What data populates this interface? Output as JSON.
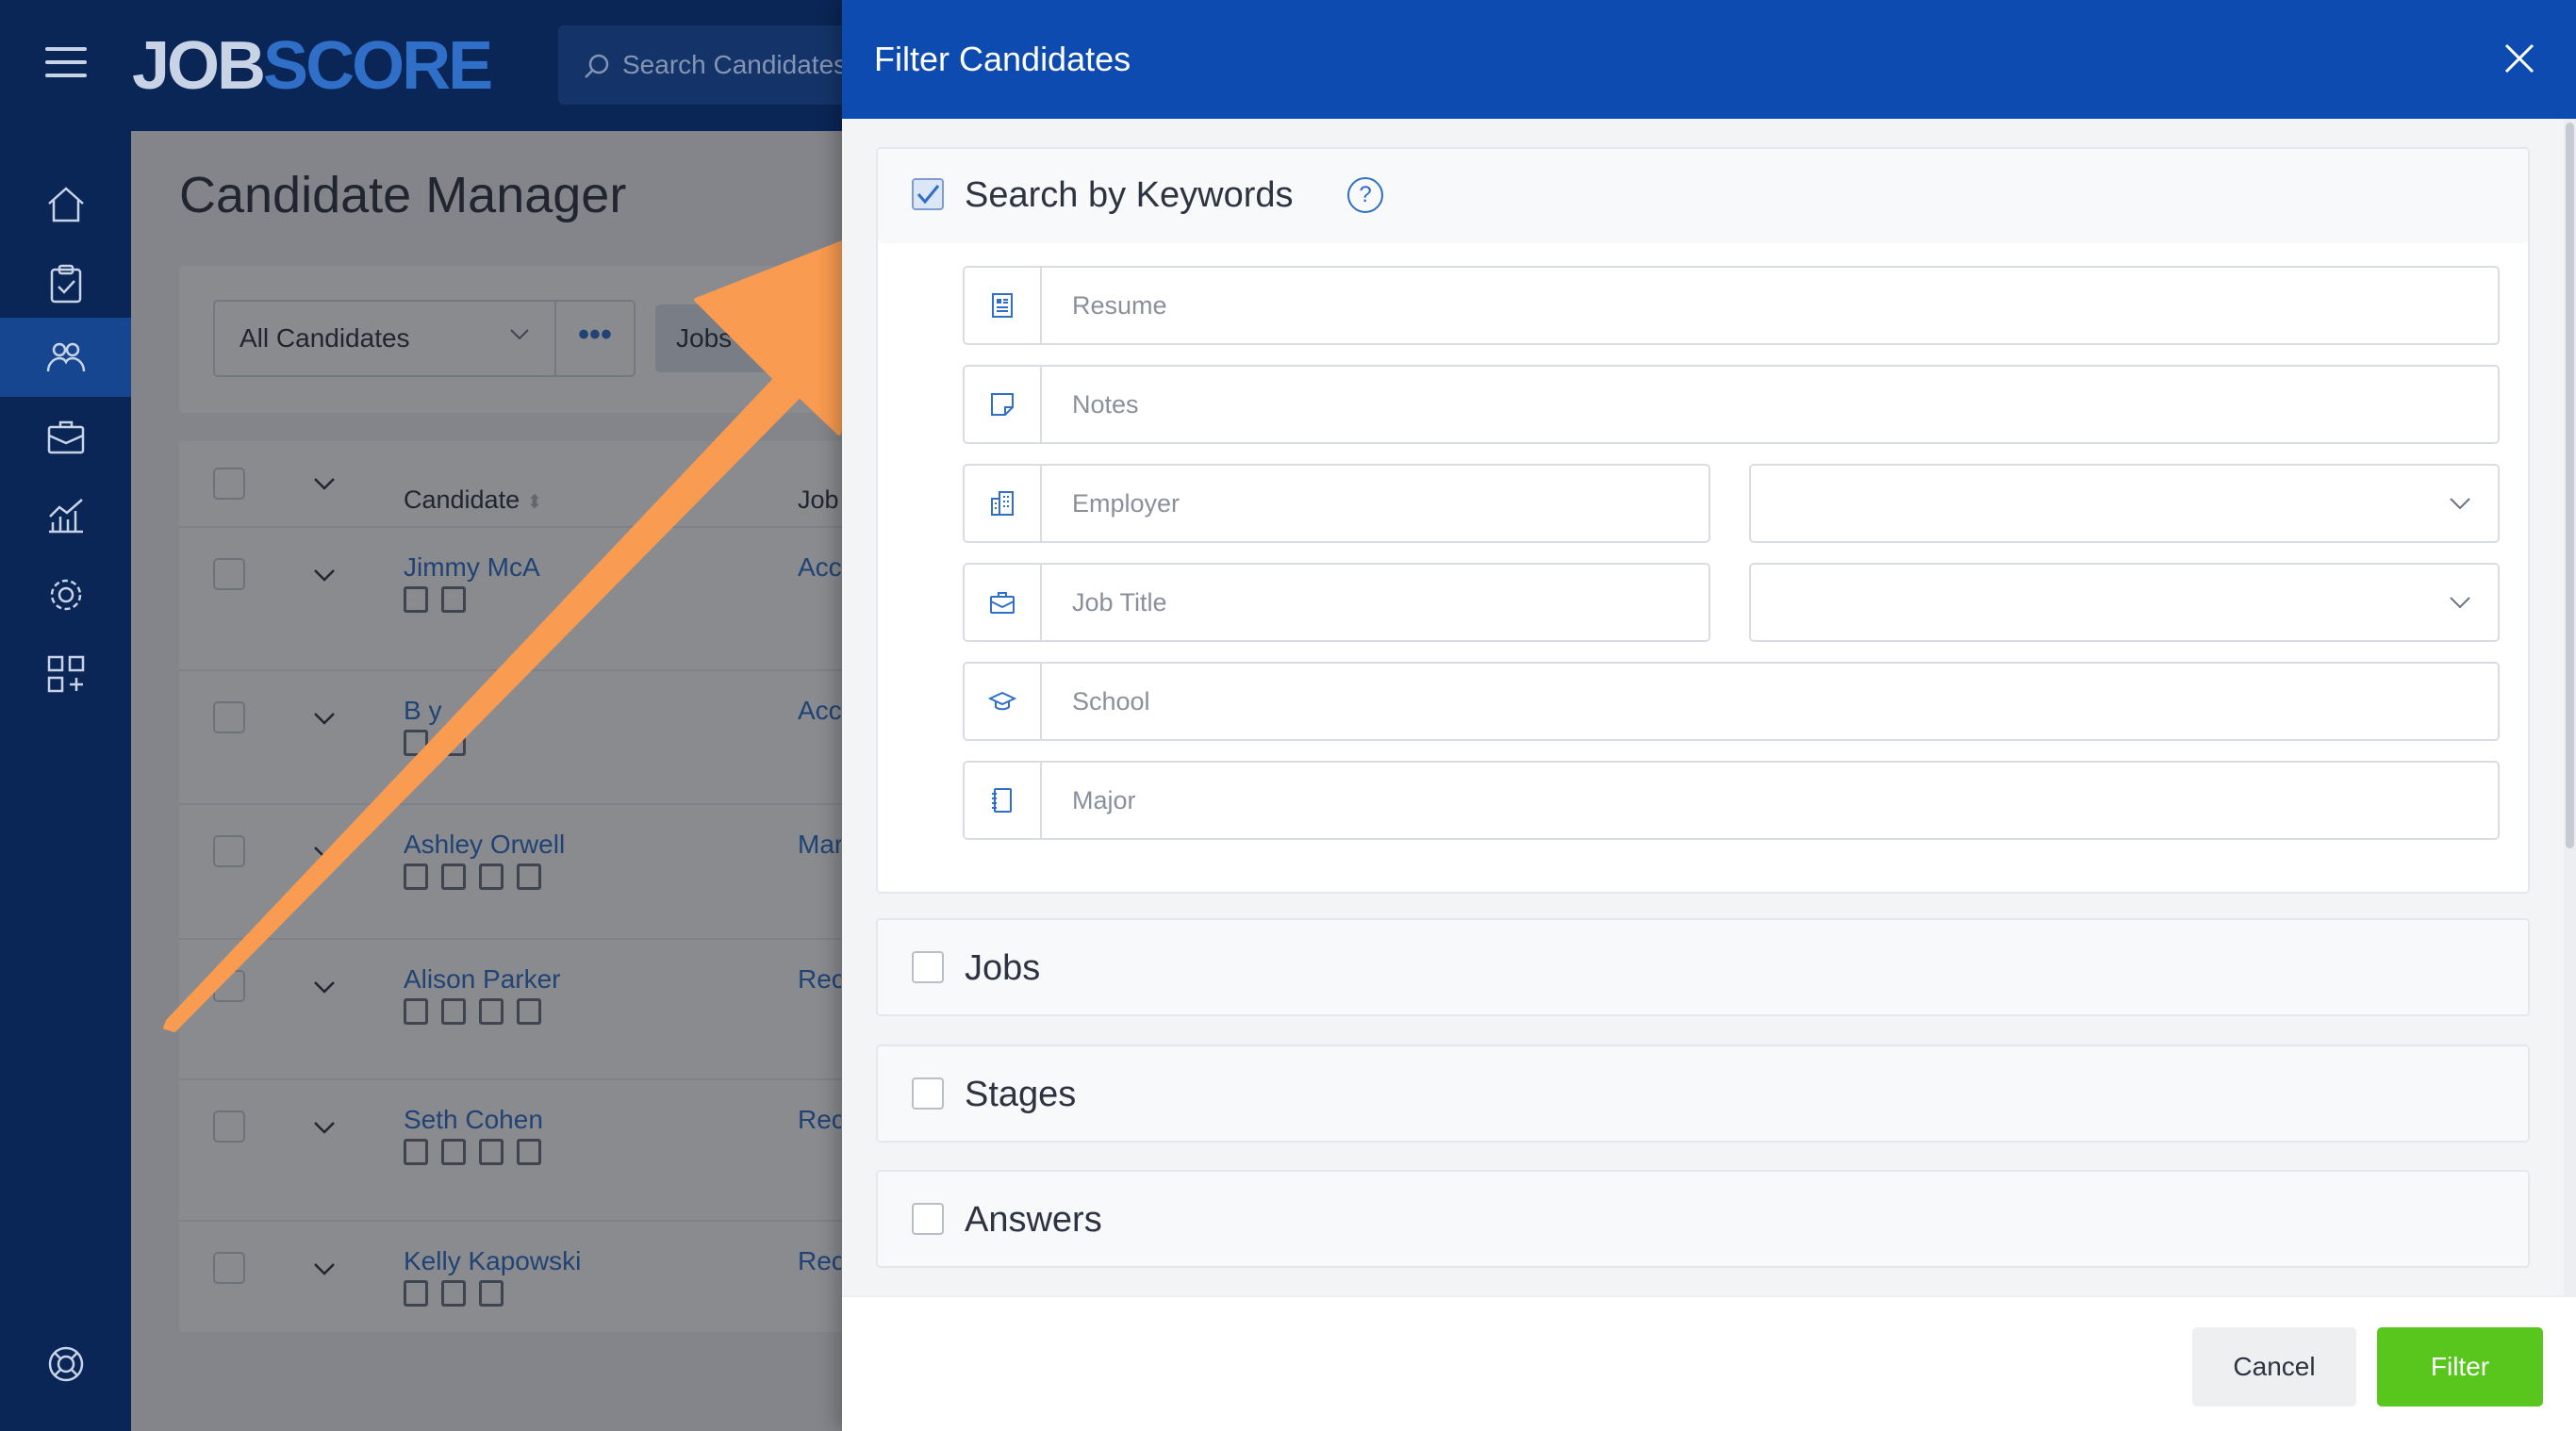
{
  "app": {
    "logo_part1": "JOB",
    "logo_part2": "SCORE",
    "search_placeholder": "Search Candidates"
  },
  "nav": {
    "items": [
      "home-icon",
      "clipboard-icon",
      "candidates-icon",
      "briefcase-icon",
      "analytics-icon",
      "settings-icon",
      "apps-icon"
    ],
    "help": "lifebuoy-icon",
    "active": "candidates-icon"
  },
  "page": {
    "title": "Candidate Manager",
    "list_filter": "All Candidates",
    "more_label": "•••",
    "jobs_button": "Jobs",
    "columns": {
      "candidate": "Candidate",
      "job": "Job"
    },
    "rows": [
      {
        "name": "Jimmy McA",
        "job": "Acc"
      },
      {
        "name": "B      y",
        "job": "Acc"
      },
      {
        "name": "Ashley Orwell",
        "job": "Mar"
      },
      {
        "name": "Alison Parker",
        "job": "Rec"
      },
      {
        "name": "Seth Cohen",
        "job": "Rec"
      },
      {
        "name": "Kelly Kapowski",
        "job": "Rec"
      }
    ]
  },
  "modal": {
    "title": "Filter Candidates",
    "keywords": {
      "label": "Search by Keywords",
      "checked": true,
      "help_glyph": "?",
      "fields": {
        "resume": "Resume",
        "notes": "Notes",
        "employer": "Employer",
        "job_title": "Job Title",
        "school": "School",
        "major": "Major"
      }
    },
    "sections": {
      "jobs": "Jobs",
      "stages": "Stages",
      "answers": "Answers"
    },
    "buttons": {
      "cancel": "Cancel",
      "filter": "Filter"
    }
  },
  "colors": {
    "header_blue": "#0e4bb0",
    "nav_dark": "#0a2656",
    "link_blue": "#2f6fc8",
    "filter_green": "#58c61c",
    "arrow_orange": "#f99b50"
  }
}
